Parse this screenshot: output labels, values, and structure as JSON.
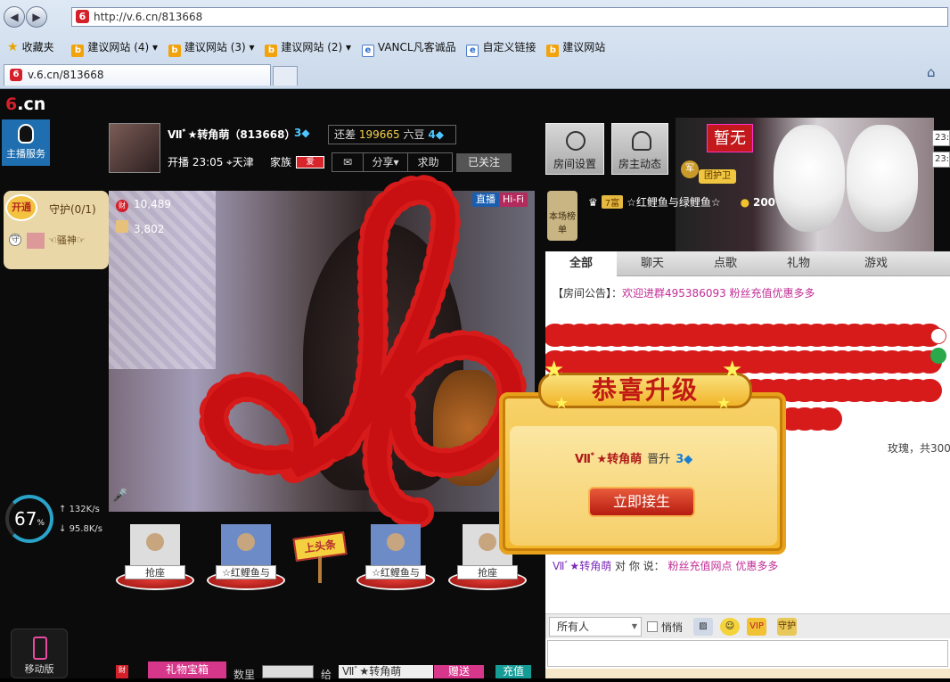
{
  "browser": {
    "url": "http://v.6.cn/813668",
    "favorites": [
      "收藏夹",
      "建议网站 (4)",
      "建议网站 (3)",
      "建议网站 (2)",
      "VANCL凡客诚品",
      "自定义链接",
      "建议网站"
    ],
    "tab_title": "v.6.cn/813668"
  },
  "site": {
    "logo": "6.cn",
    "anchor_service": "主播服务",
    "open_label": "开通",
    "guard_label": "守护(0/1)",
    "guard_member": "☜骚神☞",
    "cpu_percent": "67",
    "net_up": "132K/s",
    "net_down": "95.8K/s",
    "mobile_label": "移动版"
  },
  "host": {
    "name": "Ⅶﾞ★转角萌（813668）",
    "level": "3",
    "gap_prefix": "还差",
    "gap_value": "199665",
    "gap_unit": "六豆",
    "gap_level": "4",
    "start_time": "开播 23:05",
    "location": "天津",
    "family_label": "家族",
    "family_badge": "爱",
    "share_label": "分享",
    "report_label": "求助",
    "followed_label": "已关注"
  },
  "video": {
    "wealth": "10,489",
    "fans": "3,802",
    "live_tag": "直播",
    "hifi_tag": "Hi-Fi"
  },
  "seats": [
    {
      "label": "抢座"
    },
    {
      "label": "☆红鲤鱼与"
    },
    {
      "label": "☆红鲤鱼与"
    },
    {
      "label": "抢座"
    }
  ],
  "toutiao_label": "上头条",
  "giftbar": {
    "cai": "财",
    "gift_box": "礼物宝箱",
    "qty_label": "数里",
    "give_label": "给",
    "recipient": "Ⅶﾞ★转角萌",
    "send": "赠送",
    "recharge": "充值"
  },
  "right": {
    "room_settings": "房间设置",
    "host_news": "房主动态",
    "zanwu": "暂无",
    "jun": "军",
    "tuanhuwei": "团护卫",
    "times": [
      "23:",
      "23:"
    ],
    "rank_label": "本场榜单",
    "top_rank_level": "7富",
    "top_user": "☆红鲤鱼与绿鲤鱼☆",
    "top_coins": "200",
    "tabs": [
      "全部",
      "聊天",
      "点歌",
      "礼物",
      "游戏"
    ],
    "notice_prefix": "【房间公告】：",
    "notice_text": "欢迎进群495386093 粉丝充值优惠多多",
    "rose_text": "玫瑰，共300",
    "chat_name": "Ⅶﾞ★转角萌",
    "chat_mid": "对 你 说：",
    "chat_msg": "粉丝充值网点 优惠多多",
    "to_whom": "所有人",
    "whisper": "悄悄",
    "vip": "VIP",
    "guard_tool": "守护"
  },
  "celebration": {
    "title": "恭喜升级",
    "name": "Ⅶﾞ★转角萌",
    "up": "晋升",
    "level": "3",
    "button": "立即接生"
  },
  "colors": {
    "brand_red": "#d3202a",
    "gift_pink": "#d7378b",
    "recharge_teal": "#159c96",
    "gold": "#f3b72b"
  }
}
